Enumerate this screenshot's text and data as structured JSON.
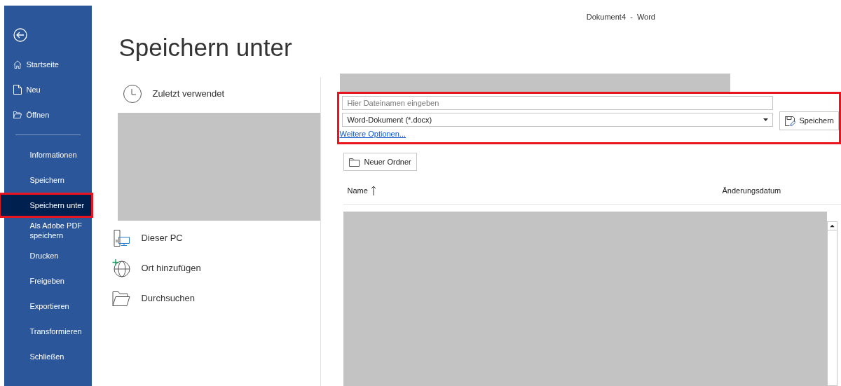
{
  "window": {
    "title": "Dokument4  -  Word"
  },
  "sidebar": {
    "items": [
      {
        "label": "Startseite",
        "kind": "home",
        "selected": false,
        "highlighted": false
      },
      {
        "label": "Neu",
        "kind": "new",
        "selected": false,
        "highlighted": false
      },
      {
        "label": "Öffnen",
        "kind": "open",
        "selected": false,
        "highlighted": false
      },
      {
        "label": "Informationen",
        "kind": "plain",
        "selected": false,
        "highlighted": false
      },
      {
        "label": "Speichern",
        "kind": "plain",
        "selected": false,
        "highlighted": false
      },
      {
        "label": "Speichern unter",
        "kind": "plain",
        "selected": true,
        "highlighted": true
      },
      {
        "label": "Als Adobe PDF speichern",
        "kind": "plain",
        "selected": false,
        "highlighted": false
      },
      {
        "label": "Drucken",
        "kind": "plain",
        "selected": false,
        "highlighted": false
      },
      {
        "label": "Freigeben",
        "kind": "plain",
        "selected": false,
        "highlighted": false
      },
      {
        "label": "Exportieren",
        "kind": "plain",
        "selected": false,
        "highlighted": false
      },
      {
        "label": "Transformieren",
        "kind": "plain",
        "selected": false,
        "highlighted": false
      },
      {
        "label": "Schließen",
        "kind": "plain",
        "selected": false,
        "highlighted": false
      }
    ]
  },
  "page_title": "Speichern unter",
  "locations": [
    {
      "label": "Zuletzt verwendet",
      "kind": "recent"
    },
    {
      "label": "Dieser PC",
      "kind": "pc"
    },
    {
      "label": "Ort hinzufügen",
      "kind": "add"
    },
    {
      "label": "Durchsuchen",
      "kind": "browse"
    }
  ],
  "save_form": {
    "highlighted": true,
    "filename": {
      "placeholder": "Hier Dateinamen eingeben"
    },
    "file_type": "Word-Dokument (*.docx)",
    "more_options": "Weitere Optionen...",
    "save_button": "Speichern"
  },
  "new_folder_button": "Neuer Ordner",
  "file_list": {
    "columns": [
      "Name",
      "Änderungsdatum"
    ]
  }
}
